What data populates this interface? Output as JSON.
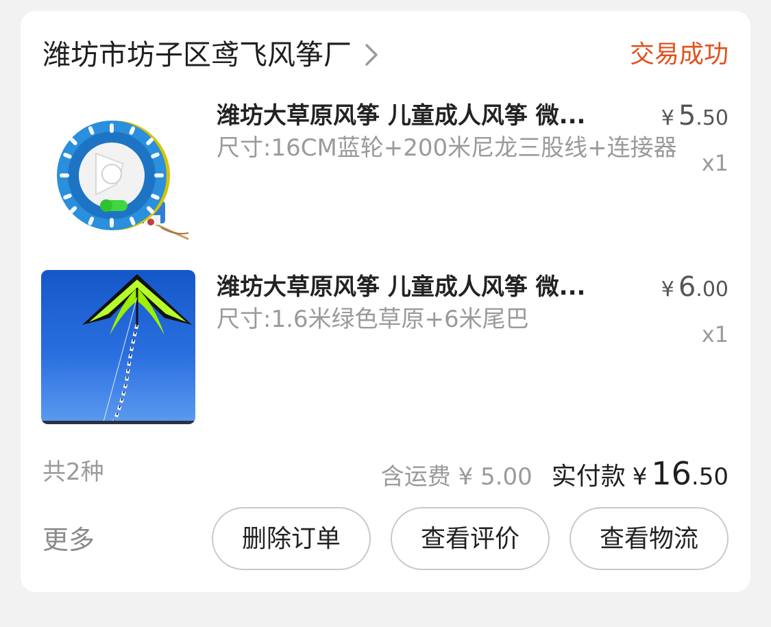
{
  "shop": {
    "name": "潍坊市坊子区鸢飞风筝厂",
    "status": "交易成功"
  },
  "items": [
    {
      "title": "潍坊大草原风筝 儿童成人风筝 微...",
      "spec": "尺寸:16CM蓝轮+200米尼龙三股线+连接器",
      "price": {
        "currency": "¥",
        "integer": "5",
        "decimal": ".50"
      },
      "qty": "x1",
      "image_icon": "kite-reel-image"
    },
    {
      "title": "潍坊大草原风筝 儿童成人风筝 微...",
      "spec": "尺寸:1.6米绿色草原+6米尾巴",
      "price": {
        "currency": "¥",
        "integer": "6",
        "decimal": ".00"
      },
      "qty": "x1",
      "image_icon": "kite-sky-image"
    }
  ],
  "summary": {
    "count": "共2种",
    "shipping": "含运费 ¥ 5.00",
    "paid_label": "实付款",
    "paid_currency": "¥",
    "paid_integer": "16",
    "paid_decimal": ".50"
  },
  "actions": {
    "more": "更多",
    "delete": "删除订单",
    "review": "查看评价",
    "logistics": "查看物流"
  },
  "colors": {
    "status": "#e2511c",
    "background": "#f2f2f2",
    "card": "#ffffff"
  }
}
